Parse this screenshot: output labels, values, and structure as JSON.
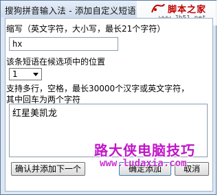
{
  "window": {
    "title": "搜狗拼音输入法 - 添加自定义短语"
  },
  "form": {
    "abbr_label": "缩写（英文字符，大小写，最长21个字符）",
    "abbr_value": "hx",
    "position_label": "该条短语在候选项中的位置",
    "position_value": "1",
    "content_label_line1": "支持多行，空格，最长30000个汉字或英文字符，",
    "content_label_line2": "其中回车为两个字符",
    "content_value": "红星美凯龙"
  },
  "buttons": {
    "confirm_add_next": "确认并添加下一个",
    "confirm_add": "确定添加",
    "cancel": "取消"
  },
  "watermarks": {
    "top_text": "脚本之家",
    "top_url": "www.Jb51.net",
    "big_text": "路大侠电脑技巧",
    "big_url": "www.ludaxia.com"
  },
  "colors": {
    "watermark_big": "#c214c9",
    "watermark_top": "#c00000",
    "window_frame": "#dce7f4"
  }
}
